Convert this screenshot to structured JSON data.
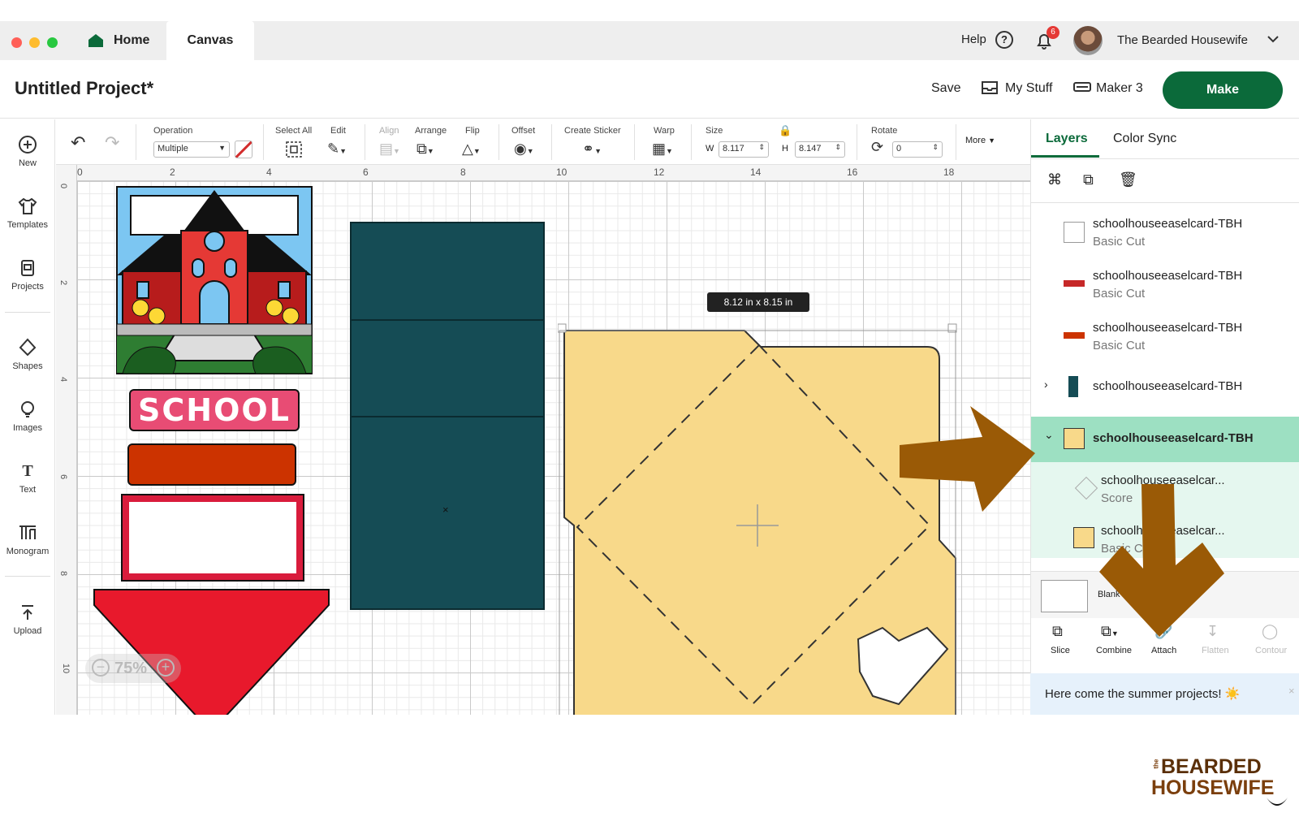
{
  "tabs": {
    "home": "Home",
    "canvas": "Canvas"
  },
  "header": {
    "help": "Help",
    "notifications_count": "6",
    "user_name": "The Bearded Housewife",
    "project_title": "Untitled Project*",
    "save": "Save",
    "my_stuff": "My Stuff",
    "machine": "Maker 3",
    "make": "Make"
  },
  "sidebar": {
    "items": [
      {
        "label": "New",
        "icon": "plus-circle-icon"
      },
      {
        "label": "Templates",
        "icon": "shirt-icon"
      },
      {
        "label": "Projects",
        "icon": "projects-icon"
      },
      {
        "label": "Shapes",
        "icon": "shapes-icon"
      },
      {
        "label": "Images",
        "icon": "lightbulb-icon"
      },
      {
        "label": "Text",
        "icon": "text-icon"
      },
      {
        "label": "Monogram",
        "icon": "monogram-icon"
      },
      {
        "label": "Upload",
        "icon": "upload-icon"
      }
    ]
  },
  "toolbar": {
    "operation_label": "Operation",
    "operation_value": "Multiple",
    "select_all": "Select All",
    "edit": "Edit",
    "align": "Align",
    "arrange": "Arrange",
    "flip": "Flip",
    "offset": "Offset",
    "create_sticker": "Create Sticker",
    "warp": "Warp",
    "size": "Size",
    "w_label": "W",
    "w_value": "8.117",
    "h_label": "H",
    "h_value": "8.147",
    "rotate": "Rotate",
    "rotate_value": "0",
    "more": "More"
  },
  "canvas": {
    "ruler_top": [
      "0",
      "2",
      "4",
      "6",
      "8",
      "10",
      "12",
      "14",
      "16",
      "18"
    ],
    "ruler_left": [
      "0",
      "2",
      "4",
      "6",
      "8",
      "10"
    ],
    "dimension_tooltip": "8.12  in x 8.15  in",
    "zoom": "75%",
    "school_text": "SCHOOL"
  },
  "panel": {
    "tab_layers": "Layers",
    "tab_color_sync": "Color Sync",
    "layers": [
      {
        "name": "schoolhouseeaselcard-TBH",
        "sub": "Basic Cut",
        "color": "#ffffff"
      },
      {
        "name": "schoolhouseeaselcard-TBH",
        "sub": "Basic Cut",
        "color": "#c62828"
      },
      {
        "name": "schoolhouseeaselcard-TBH",
        "sub": "Basic Cut",
        "color": "#cc3300"
      },
      {
        "name": "schoolhouseeaselcard-TBH",
        "sub": "",
        "color": "#154c55"
      },
      {
        "name": "schoolhouseeaselcard-TBH",
        "sub": "",
        "color": "#f8d98a"
      },
      {
        "name": "schoolhouseeaselcar...",
        "sub": "Score",
        "color": "#ffffff"
      },
      {
        "name": "schoolhouseeaselcar...",
        "sub": "Basic Cut",
        "color": "#f8d98a"
      }
    ],
    "blank_canvas": "Blank Canvas",
    "actions": [
      "Slice",
      "Combine",
      "Attach",
      "Flatten",
      "Contour"
    ],
    "banner": "Here come the summer projects! ☀️"
  },
  "watermark": {
    "small": "the",
    "line1": "BEARDED",
    "line2": "HOUSEWIFE"
  }
}
